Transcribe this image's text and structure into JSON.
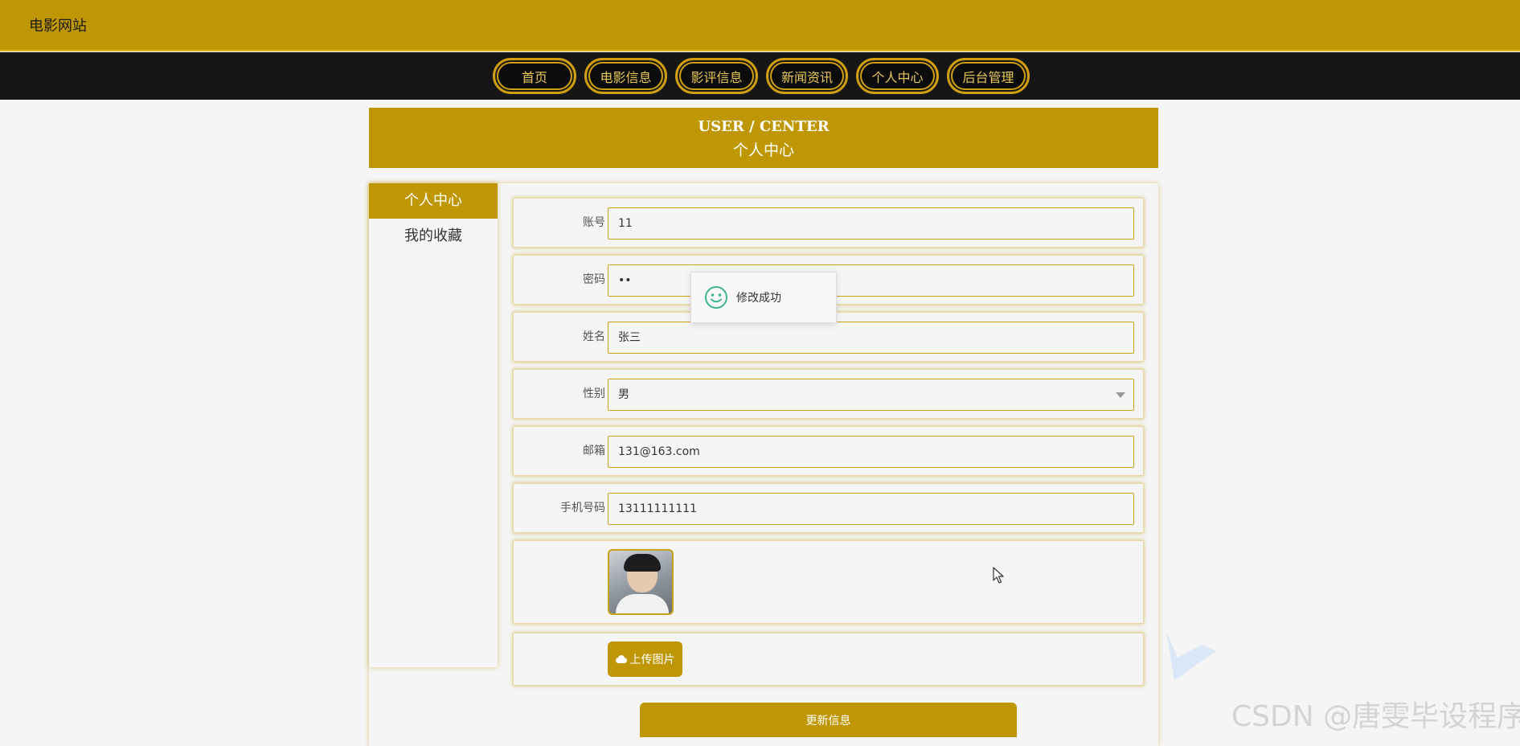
{
  "header": {
    "site_title": "电影网站"
  },
  "nav": {
    "items": [
      {
        "label": "首页"
      },
      {
        "label": "电影信息"
      },
      {
        "label": "影评信息"
      },
      {
        "label": "新闻资讯"
      },
      {
        "label": "个人中心"
      },
      {
        "label": "后台管理"
      }
    ]
  },
  "banner": {
    "title_en": "USER / CENTER",
    "title_cn": "个人中心"
  },
  "sidebar": {
    "items": [
      {
        "label": "个人中心",
        "active": true
      },
      {
        "label": "我的收藏",
        "active": false
      }
    ]
  },
  "form": {
    "account": {
      "label": "账号",
      "value": "11"
    },
    "password": {
      "label": "密码",
      "value": "••"
    },
    "name": {
      "label": "姓名",
      "value": "张三"
    },
    "gender": {
      "label": "性别",
      "value": "男"
    },
    "email": {
      "label": "邮箱",
      "value": "131@163.com"
    },
    "phone": {
      "label": "手机号码",
      "value": "13111111111"
    },
    "upload_label": "上传图片",
    "submit_label": "更新信息"
  },
  "toast": {
    "message": "修改成功"
  },
  "watermark": "CSDN @唐雯毕设程序",
  "colors": {
    "accent": "#bf9704",
    "nav_bg": "#161616",
    "nav_text": "#e8c75a",
    "success_icon": "#3fb58f"
  }
}
